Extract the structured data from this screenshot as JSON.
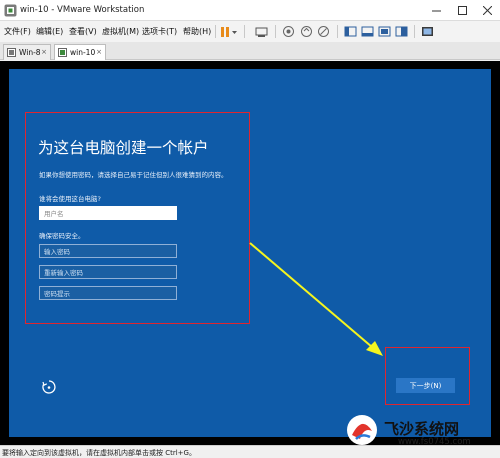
{
  "window": {
    "title": "win-10 - VMware Workstation",
    "controls": [
      "minimize",
      "maximize",
      "close"
    ]
  },
  "menu": {
    "items": [
      "文件(F)",
      "编辑(E)",
      "查看(V)",
      "虚拟机(M)",
      "选项卡(T)",
      "帮助(H)"
    ]
  },
  "toolbar": {
    "icons": [
      "pause-icon",
      "send-keys-icon",
      "snapshot-icon",
      "revert-snapshot-icon",
      "snapshot-manager-icon",
      "sidebar-icon",
      "thumbnail-icon",
      "fullscreen-icon",
      "unity-icon",
      "console-view-icon"
    ]
  },
  "tabs": [
    {
      "label": "Win-8",
      "active": false
    },
    {
      "label": "win-10",
      "active": true
    }
  ],
  "setup": {
    "heading": "为这台电脑创建一个帐户",
    "intro": "如果你想使用密码，请选择自己易于记住但别人很难猜到的内容。",
    "user_prompt": "谁将会使用这台电脑?",
    "username_placeholder": "用户名",
    "password_prompt": "确保密码安全。",
    "password_placeholder": "输入密码",
    "confirm_placeholder": "重新输入密码",
    "hint_placeholder": "密码提示",
    "next_button": "下一步(N)"
  },
  "status": {
    "text": "要将输入定向到该虚拟机，请在虚拟机内部单击或按 Ctrl+G。"
  },
  "watermark": {
    "title": "飞沙系统网",
    "url": "www.fs0745.com"
  },
  "colors": {
    "oobe_blue": "#0f5ba8",
    "highlight_red": "#e0262f",
    "arrow_yellow": "#f5f51e"
  }
}
